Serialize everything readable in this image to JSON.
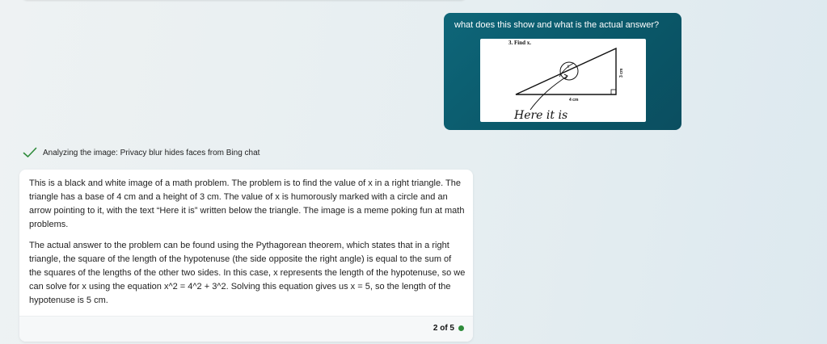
{
  "user_message": {
    "text": "what does this show and what is the actual answer?",
    "image": {
      "problem_label": "3. Find x.",
      "variable": "x",
      "side_label_vertical": "3 cm",
      "side_label_base": "4 cm",
      "handwritten": "Here it is"
    }
  },
  "status": {
    "icon": "check-icon",
    "text": "Analyzing the image: Privacy blur hides faces from Bing chat",
    "color": "#2e8b3a"
  },
  "bot_response": {
    "paragraphs": [
      "This is a black and white image of a math problem. The problem is to find the value of x in a right triangle. The triangle has a base of 4 cm and a height of 3 cm. The value of x is humorously marked with a circle and an arrow pointing to it, with the text “Here it is” written below the triangle. The image is a meme poking fun at math problems.",
      "The actual answer to the problem can be found using the Pythagorean theorem, which states that in a right triangle, the square of the length of the hypotenuse (the side opposite the right angle) is equal to the sum of the squares of the lengths of the other two sides. In this case, x represents the length of the hypotenuse, so we can solve for x using the equation x^2 = 4^2 + 3^2. Solving this equation gives us x = 5, so the length of the hypotenuse is 5 cm."
    ],
    "pager": "2 of 5"
  }
}
